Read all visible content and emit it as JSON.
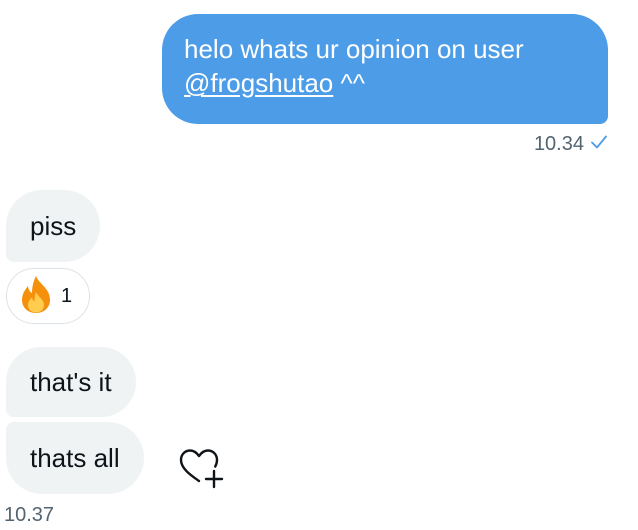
{
  "sent_message": {
    "text_line1": "helo whats ur opinion on user",
    "mention": "@frogshutao",
    "text_after_mention": " ^^",
    "time": "10.34",
    "status_icon": "checkmark-icon"
  },
  "received_messages": [
    {
      "text": "piss",
      "reaction": {
        "icon": "fire-emoji",
        "count": "1"
      }
    },
    {
      "text": "that's it"
    },
    {
      "text": "thats all"
    }
  ],
  "received_time": "10.37",
  "react_button_icon": "heart-plus-icon",
  "colors": {
    "sent_bubble": "#4c9ce8",
    "received_bubble": "#eff3f4",
    "timestamp": "#536471",
    "check": "#4c9ce8"
  }
}
